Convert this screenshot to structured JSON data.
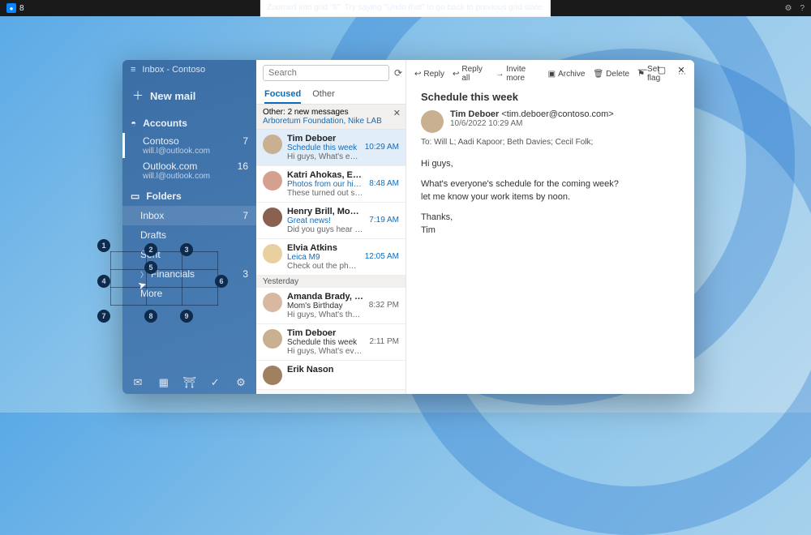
{
  "topbar": {
    "num": "8",
    "msg": "Zoomed into grid \"8\". Try saying \"Undo that\" to go back to previous grid state."
  },
  "window": {
    "title": "Inbox - Contoso"
  },
  "sidebar": {
    "newmail": "New mail",
    "accounts_label": "Accounts",
    "accounts": [
      {
        "name": "Contoso",
        "email": "will.l@outlook.com",
        "count": "7"
      },
      {
        "name": "Outlook.com",
        "email": "will.l@outlook.com",
        "count": "16"
      }
    ],
    "folders_label": "Folders",
    "folders": [
      {
        "name": "Inbox",
        "count": "7"
      },
      {
        "name": "Drafts",
        "count": ""
      },
      {
        "name": "Sent",
        "count": ""
      },
      {
        "name": "Financials",
        "count": "3",
        "expandable": true
      },
      {
        "name": "More",
        "count": ""
      }
    ]
  },
  "list": {
    "search_placeholder": "Search",
    "tabs": {
      "focused": "Focused",
      "other": "Other"
    },
    "other_bar": {
      "title": "Other: 2 new messages",
      "senders": "Arboretum Foundation, Nike LAB"
    },
    "day_separator": "Yesterday",
    "messages": [
      {
        "from": "Tim Deboer",
        "subject": "Schedule this week",
        "preview": "Hi guys, What's everyone's sche",
        "time": "10:29 AM"
      },
      {
        "from": "Katri Ahokas, Erik Nason",
        "subject": "Photos from our hike on Maple",
        "preview": "These turned out so good! xx",
        "time": "8:48 AM"
      },
      {
        "from": "Henry Brill, Mona Kane, Cecil F",
        "subject": "Great news!",
        "preview": "Did you guys hear about Robin'",
        "time": "7:19 AM"
      },
      {
        "from": "Elvia Atkins",
        "subject": "Leica M9",
        "preview": "Check out the photos from this",
        "time": "12:05 AM"
      },
      {
        "from": "Amanda Brady, Daisy Phillips",
        "subject": "Mom's Birthday",
        "preview": "Hi guys, What's the plan for the",
        "time": "8:32 PM"
      },
      {
        "from": "Tim Deboer",
        "subject": "Schedule this week",
        "preview": "Hi guys, What's everyone's plan",
        "time": "2:11 PM"
      },
      {
        "from": "Erik Nason",
        "subject": "",
        "preview": "",
        "time": ""
      }
    ]
  },
  "pane": {
    "actions": {
      "reply": "Reply",
      "replyall": "Reply all",
      "invite": "Invite more",
      "archive": "Archive",
      "delete": "Delete",
      "setflag": "Set flag"
    },
    "subject": "Schedule this week",
    "sender_name": "Tim Deboer",
    "sender_email": "<tim.deboer@contoso.com>",
    "date": "10/6/2022 10:29 AM",
    "to_label": "To:",
    "to": "Will L; Aadi Kapoor; Beth Davies; Cecil Folk;",
    "body": [
      "Hi guys,",
      "What's everyone's schedule for the coming week?\nlet me know your work items by noon.",
      "Thanks,\nTim"
    ]
  },
  "grid_numbers": [
    "1",
    "2",
    "3",
    "4",
    "5",
    "6",
    "7",
    "8",
    "9"
  ]
}
